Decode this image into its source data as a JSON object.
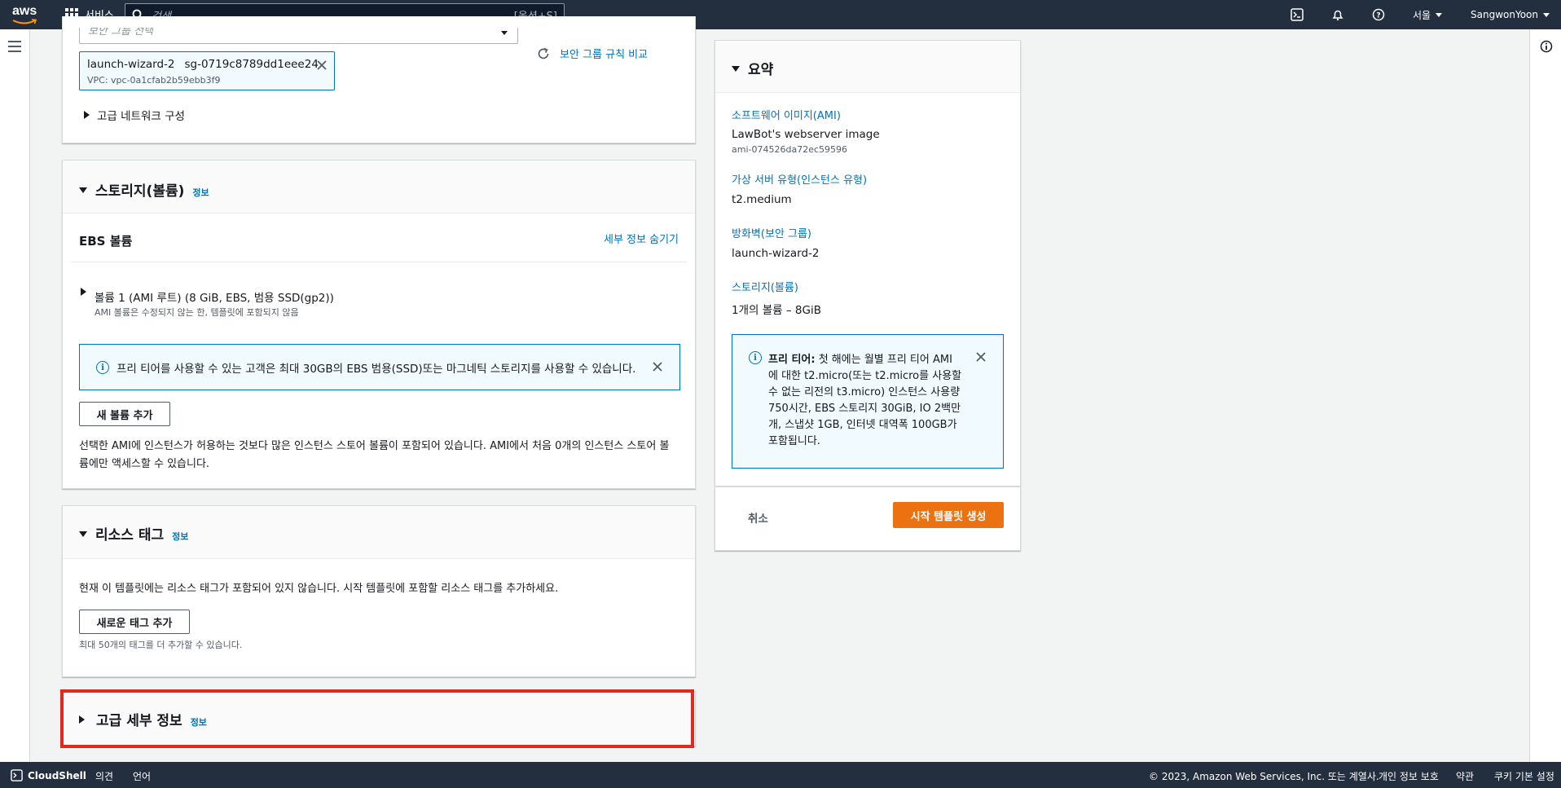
{
  "topnav": {
    "logo_text": "aws",
    "services_label": "서비스",
    "search_placeholder": "검색",
    "search_shortcut": "[옵션+S]",
    "region": "서울",
    "user": "SangwonYoon"
  },
  "network": {
    "sg_select_placeholder": "보안 그룹 선택",
    "compare_link": "보안 그룹 규칙 비교",
    "token_name": "launch-wizard-2",
    "token_id": "sg-0719c8789dd1eee24",
    "token_vpc": "VPC: vpc-0a1cfab2b59ebb3f9",
    "advanced_network": "고급 네트워크 구성"
  },
  "storage": {
    "title": "스토리지(볼륨)",
    "info": "정보",
    "ebs_title": "EBS 볼륨",
    "hide_details": "세부 정보 숨기기",
    "volume_label": "볼륨 1 (AMI 루트) (8 GiB, EBS, 범용 SSD(gp2))",
    "volume_desc": "AMI 볼륨은 수정되지 않는 한, 템플릿에 포함되지 않음",
    "free_tier_alert": "프리 티어를 사용할 수 있는 고객은 최대 30GB의 EBS 범용(SSD)또는 마그네틱 스토리지를 사용할 수 있습니다.",
    "add_volume": "새 볼륨 추가",
    "instance_store_note_1": "선택한 AMI에 인스턴스가 허용하는 것보다 많은 인스턴스 스토어 볼륨이 포함되어 있습니다. AMI에서 처음 0개의 인스턴스 스토어 볼",
    "instance_store_note_2": "륨에만 액세스할 수 있습니다."
  },
  "tags": {
    "title": "리소스 태그",
    "info": "정보",
    "empty_text": "현재 이 템플릿에는 리소스 태그가 포함되어 있지 않습니다. 시작 템플릿에 포함할 리소스 태그를 추가하세요.",
    "add_tag": "새로운 태그 추가",
    "limit_note": "최대 50개의 태그를 더 추가할 수 있습니다."
  },
  "advanced": {
    "title": "고급 세부 정보",
    "info": "정보"
  },
  "summary": {
    "title": "요약",
    "ami_label": "소프트웨어 이미지(AMI)",
    "ami_name": "LawBot's webserver image",
    "ami_id": "ami-074526da72ec59596",
    "instance_type_label": "가상 서버 유형(인스턴스 유형)",
    "instance_type": "t2.medium",
    "firewall_label": "방화벽(보안 그룹)",
    "firewall": "launch-wizard-2",
    "storage_label": "스토리지(볼륨)",
    "storage": "1개의 볼륨 – 8GiB",
    "free_tier_title": "프리 티어:",
    "free_tier_lines": [
      " 첫 해에는 월별 프리 티어 AMI",
      "에 대한 t2.micro(또는 t2.micro를 사용할",
      "수 없는 리전의 t3.micro) 인스턴스 사용량",
      "750시간, EBS 스토리지 30GiB, IO 2백만",
      "개, 스냅샷 1GB, 인터넷 대역폭 100GB가",
      "포함됩니다."
    ],
    "cancel": "취소",
    "create": "시작 템플릿 생성"
  },
  "footer": {
    "cloudshell": "CloudShell",
    "feedback": "의견",
    "language": "언어",
    "copyright": "© 2023, Amazon Web Services, Inc. 또는 계열사.",
    "privacy": "개인 정보 보호",
    "terms": "약관",
    "cookies": "쿠키 기본 설정"
  },
  "colors": {
    "nav": "#232f3e",
    "link": "#0073bb",
    "primary": "#ec7211",
    "highlight": "#e02a20"
  }
}
